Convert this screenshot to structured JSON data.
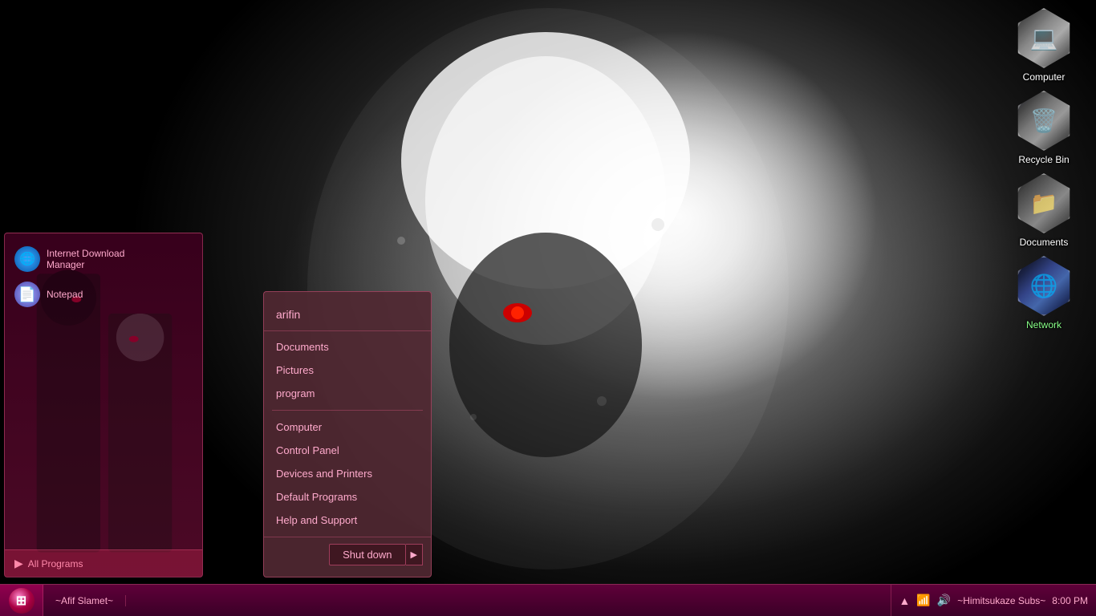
{
  "desktop": {
    "icons": [
      {
        "id": "computer",
        "label": "Computer",
        "type": "computer"
      },
      {
        "id": "recycle-bin",
        "label": "Recycle Bin",
        "type": "recycle"
      },
      {
        "id": "documents",
        "label": "Documents",
        "type": "documents"
      },
      {
        "id": "network",
        "label": "Network",
        "type": "network"
      }
    ]
  },
  "start_menu": {
    "username": "arifin",
    "pinned": [
      {
        "id": "idm",
        "label": "Internet Download\nManager",
        "icon": "🌐"
      },
      {
        "id": "notepad",
        "label": "Notepad",
        "icon": "📄"
      }
    ],
    "all_programs_label": "All Programs",
    "menu_items": [
      {
        "id": "documents",
        "label": "Documents"
      },
      {
        "id": "pictures",
        "label": "Pictures"
      },
      {
        "id": "program",
        "label": "program"
      },
      {
        "id": "computer",
        "label": "Computer"
      },
      {
        "id": "control-panel",
        "label": "Control Panel"
      },
      {
        "id": "devices-printers",
        "label": "Devices and Printers"
      },
      {
        "id": "default-programs",
        "label": "Default Programs"
      },
      {
        "id": "help-support",
        "label": "Help and Support"
      }
    ],
    "shutdown_label": "Shut down"
  },
  "taskbar": {
    "start_label": "⊞",
    "user_label": "~Afif Slamet~",
    "right_label": "~Himitsukaze Subs~",
    "time": "8:00 PM",
    "icons": [
      "▲",
      "📶",
      "🔊"
    ]
  }
}
